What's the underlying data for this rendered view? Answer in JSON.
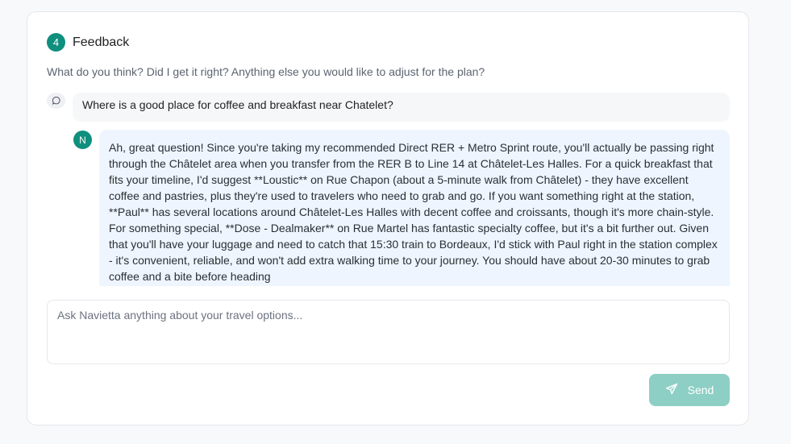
{
  "section": {
    "step_number": "4",
    "title": "Feedback",
    "prompt": "What do you think? Did I get it right? Anything else you would like to adjust for the plan?"
  },
  "messages": {
    "user": {
      "icon": "chat-bubble-icon",
      "text": "Where is a good place for coffee and breakfast near Chatelet?"
    },
    "assistant": {
      "avatar_initial": "N",
      "text": "Ah, great question! Since you're taking my recommended Direct RER + Metro Sprint route, you'll actually be passing right through the Châtelet area when you transfer from the RER B to Line 14 at Châtelet-Les Halles. For a quick breakfast that fits your timeline, I'd suggest **Loustic** on Rue Chapon (about a 5-minute walk from Châtelet) - they have excellent coffee and pastries, plus they're used to travelers who need to grab and go. If you want something right at the station, **Paul** has several locations around Châtelet-Les Halles with decent coffee and croissants, though it's more chain-style. For something special, **Dose - Dealmaker** on Rue Martel has fantastic specialty coffee, but it's a bit further out. Given that you'll have your luggage and need to catch that 15:30 train to Bordeaux, I'd stick with Paul right in the station complex - it's convenient, reliable, and won't add extra walking time to your journey. You should have about 20-30 minutes to grab coffee and a bite before heading"
    }
  },
  "composer": {
    "placeholder": "Ask Navietta anything about your travel options..."
  },
  "send_button": {
    "label": "Send",
    "icon": "paper-plane-icon"
  },
  "colors": {
    "accent": "#0f8f7d",
    "send_disabled": "#8dcfc5",
    "assistant_bubble": "#eef5fe"
  }
}
